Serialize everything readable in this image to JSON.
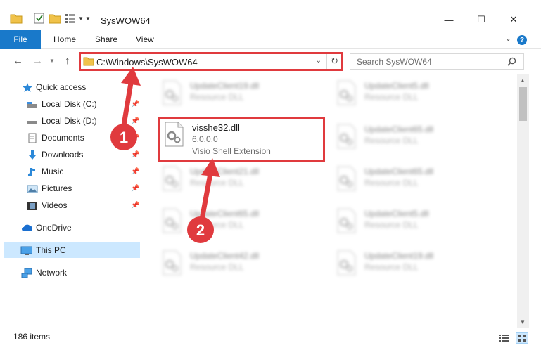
{
  "window": {
    "title": "SysWOW64",
    "controls": {
      "minimize": "—",
      "maximize": "☐",
      "close": "✕"
    }
  },
  "ribbon": {
    "tabs": [
      {
        "label": "File",
        "active": true
      },
      {
        "label": "Home"
      },
      {
        "label": "Share"
      },
      {
        "label": "View"
      }
    ],
    "help_label": "?"
  },
  "nav": {
    "address": "C:\\Windows\\SysWOW64",
    "search_placeholder": "Search SysWOW64"
  },
  "sidebar": {
    "items": [
      {
        "label": "Quick access",
        "icon": "star-icon",
        "pinned": false
      },
      {
        "label": "Local Disk (C:)",
        "icon": "drive-icon",
        "pinned": true
      },
      {
        "label": "Local Disk (D:)",
        "icon": "drive-icon",
        "pinned": true
      },
      {
        "label": "Documents",
        "icon": "documents-icon",
        "pinned": true
      },
      {
        "label": "Downloads",
        "icon": "downloads-icon",
        "pinned": true
      },
      {
        "label": "Music",
        "icon": "music-icon",
        "pinned": true
      },
      {
        "label": "Pictures",
        "icon": "pictures-icon",
        "pinned": true
      },
      {
        "label": "Videos",
        "icon": "videos-icon",
        "pinned": true
      },
      {
        "label": "OneDrive",
        "icon": "onedrive-icon",
        "pinned": false
      },
      {
        "label": "This PC",
        "icon": "computer-icon",
        "pinned": false,
        "selected": true
      },
      {
        "label": "Network",
        "icon": "network-icon",
        "pinned": false
      }
    ]
  },
  "files": {
    "highlighted": {
      "name": "visshe32.dll",
      "version": "6.0.0.0",
      "description": "Visio Shell Extension"
    },
    "left_column": [
      {
        "name": "UpdateClient19.dll",
        "type": "Resource DLL"
      },
      {
        "name": "UpdateClient21.dll",
        "type": "Resource DLL"
      },
      {
        "name": "UpdateClient65.dll",
        "type": "Resource DLL"
      },
      {
        "name": "UpdateClient42.dll",
        "type": "Resource DLL"
      }
    ],
    "right_column": [
      {
        "name": "UpdateClient5.dll",
        "type": "Resource DLL"
      },
      {
        "name": "UpdateClient65.dll",
        "type": "Resource DLL"
      },
      {
        "name": "UpdateClient65.dll",
        "type": "Resource DLL"
      },
      {
        "name": "UpdateClient5.dll",
        "type": "Resource DLL"
      },
      {
        "name": "UpdateClient19.dll",
        "type": "Resource DLL"
      }
    ]
  },
  "status": {
    "item_count": "186 items"
  },
  "annotations": {
    "step1": "1",
    "step2": "2"
  },
  "colors": {
    "accent": "#1979ca",
    "highlight": "#e03a3e",
    "selection": "#cce8ff"
  }
}
